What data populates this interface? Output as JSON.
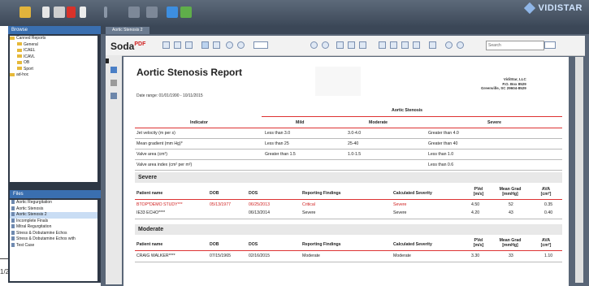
{
  "app": {
    "logo_text": "VIDISTAR"
  },
  "tabs": [
    {
      "label": "Aortic Stenosis 2"
    }
  ],
  "browse": {
    "title": "Browse",
    "tree": [
      {
        "label": "Canned Reports"
      },
      {
        "label": "General"
      },
      {
        "label": "ICAEL"
      },
      {
        "label": "ICAVL"
      },
      {
        "label": "OB"
      },
      {
        "label": "Sport"
      },
      {
        "label": "ad-hoc"
      }
    ]
  },
  "files": {
    "title": "Files",
    "items": [
      {
        "label": "Aortic Regurgitation"
      },
      {
        "label": "Aortic Stenosis"
      },
      {
        "label": "Aortic Stenosis 2"
      },
      {
        "label": "Incomplete Finals"
      },
      {
        "label": "Mitral Regurgitation"
      },
      {
        "label": "Stress & Dobutamine Echos"
      },
      {
        "label": "Stress & Dobutamine Echos with"
      },
      {
        "label": "Test Case"
      }
    ]
  },
  "viewer": {
    "brand": "Soda",
    "brand_sup": "PDF",
    "search_placeholder": "Search",
    "page_indicator": "1/2"
  },
  "report": {
    "title": "Aortic Stenosis Report",
    "date_range": "Date range:   01/01/1990  - 10/11/2015",
    "company": [
      "VidiStar, LLC",
      "P.O. Box 8529",
      "Greenville, SC 29604-8529"
    ],
    "criteria": {
      "group_header": "Aortic Stenosis",
      "indicator_header": "Indicator",
      "levels": [
        "Mild",
        "Moderate",
        "Severe"
      ],
      "rows": [
        {
          "indicator": "Jet velocity (m per s)",
          "mild": "Less than 3.0",
          "moderate": "3.0-4.0",
          "severe": "Greater than 4.0"
        },
        {
          "indicator": "Mean gradient (mm Hg)*",
          "mild": "Less than 25",
          "moderate": "25-40",
          "severe": "Greater than 40"
        },
        {
          "indicator": "Valve area (cm²)",
          "mild": "Greater than 1.5",
          "moderate": "1.0-1.5",
          "severe": "Less than 1.0"
        },
        {
          "indicator": "Valve area index (cm² per m²)",
          "mild": "",
          "moderate": "",
          "severe": "Less than 0.6"
        }
      ]
    },
    "patient_columns": [
      "Patient name",
      "DOB",
      "DOS",
      "Reporting Findings",
      "Calculated Severity",
      "PVel [m/s]",
      "Mean Grad [mmHg]",
      "AVA [cm²]"
    ],
    "sections": [
      {
        "name": "Severe",
        "rows": [
          {
            "patient": "BTOP*DEMO STUDY***",
            "dob": "05/13/1977",
            "dos": "06/25/2013",
            "finding": "Critical",
            "severity": "Severe",
            "pvel": "4.50",
            "grad": "52",
            "ava": "0.35",
            "highlight": true
          },
          {
            "patient": "IE33 ECHO****",
            "dob": "",
            "dos": "06/13/2014",
            "finding": "Severe",
            "severity": "Severe",
            "pvel": "4.20",
            "grad": "43",
            "ava": "0.40",
            "highlight": false
          }
        ]
      },
      {
        "name": "Moderate",
        "rows": [
          {
            "patient": "CRAIG WALKER****",
            "dob": "07/15/1965",
            "dos": "02/16/2015",
            "finding": "Moderate",
            "severity": "Moderate",
            "pvel": "3.30",
            "grad": "33",
            "ava": "1.10",
            "highlight": false
          }
        ]
      }
    ]
  }
}
